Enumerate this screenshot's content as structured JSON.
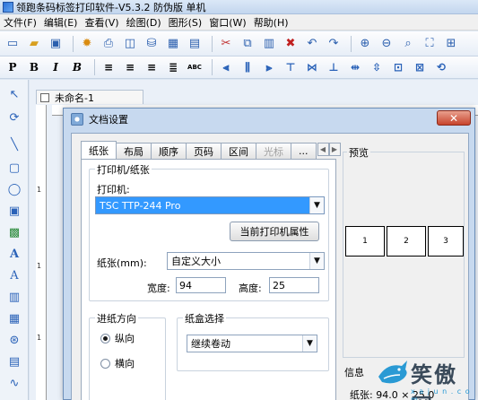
{
  "window": {
    "title": "领跑条码标签打印软件-V5.3.2 防伪版 单机"
  },
  "menu": [
    "文件(F)",
    "编辑(E)",
    "查看(V)",
    "绘图(D)",
    "图形(S)",
    "窗口(W)",
    "帮助(H)"
  ],
  "toolbar2": {
    "bold": "P",
    "bold2": "B",
    "italic": "I",
    "italic2": "B",
    "abc": "ABC"
  },
  "document": {
    "tab_label": "未命名-1",
    "ruler_marks": [
      "1",
      "1",
      "1"
    ]
  },
  "dialog": {
    "title": "文档设置",
    "close": "✕",
    "tabs": [
      "纸张",
      "布局",
      "顺序",
      "页码",
      "区间",
      "光标",
      "..."
    ],
    "printer_group": "打印机/纸张",
    "printer_label": "打印机:",
    "printer_value": "TSC TTP-244 Pro",
    "printer_props_button": "当前打印机属性",
    "paper_label": "纸张(mm):",
    "paper_value": "自定义大小",
    "width_label": "宽度:",
    "width_value": "94",
    "height_label": "高度:",
    "height_value": "25",
    "feed_group": "进纸方向",
    "feed_options": [
      "纵向",
      "横向"
    ],
    "feed_selected": "纵向",
    "tray_group": "纸盒选择",
    "tray_value": "继续卷动",
    "preview_label": "预览",
    "preview_boxes": [
      "1",
      "2",
      "3"
    ],
    "info_label": "信息",
    "info_text": "纸张: 94.0 × 25.0"
  },
  "watermark": {
    "text": "笑傲网",
    "sub": "x a j u n . c o m"
  }
}
